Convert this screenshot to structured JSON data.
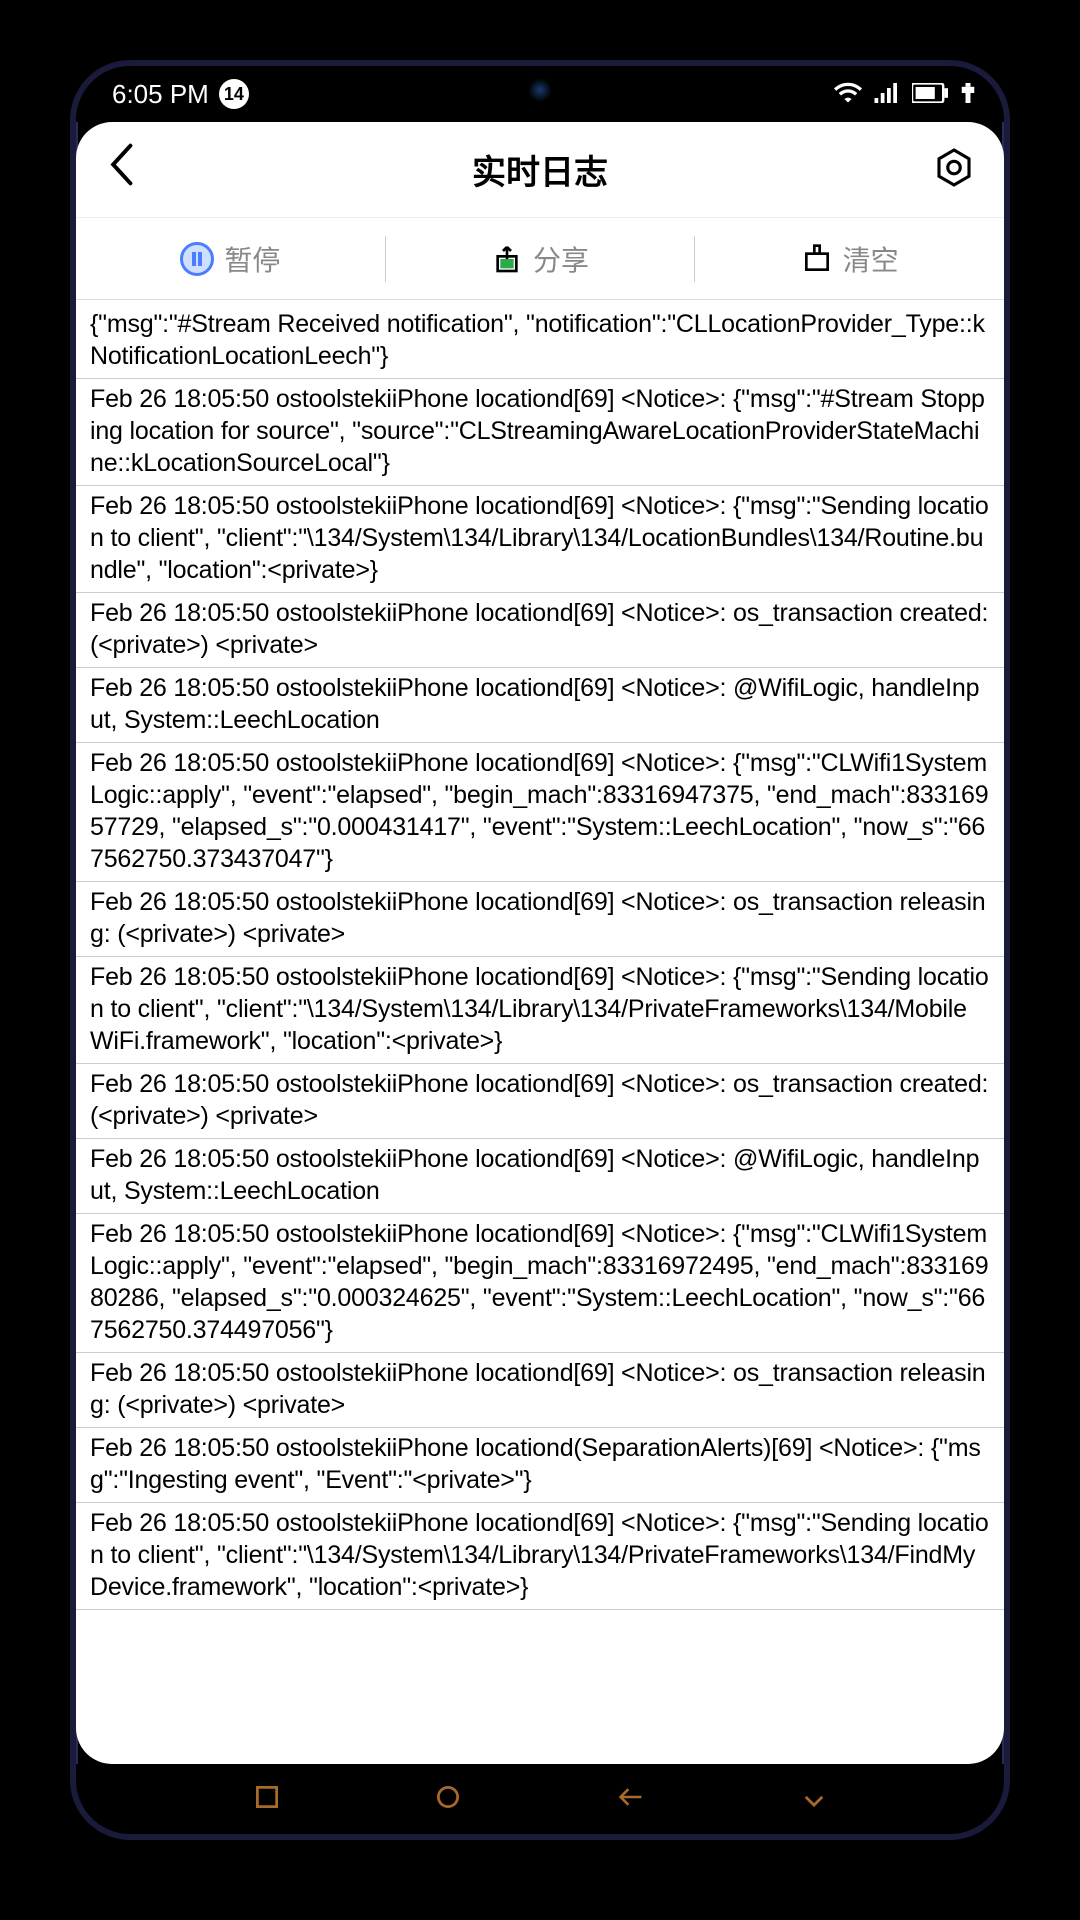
{
  "status": {
    "time": "6:05 PM",
    "notif_count": "14"
  },
  "header": {
    "title": "实时日志"
  },
  "actions": {
    "pause": "暂停",
    "share": "分享",
    "clear": "清空"
  },
  "logs": [
    "{\"msg\":\"#Stream Received notification\", \"notification\":\"CLLocationProvider_Type::kNotificationLocationLeech\"}",
    "Feb 26 18:05:50 ostoolstekiiPhone locationd[69] <Notice>: {\"msg\":\"#Stream Stopping location for source\", \"source\":\"CLStreamingAwareLocationProviderStateMachine::kLocationSourceLocal\"}",
    "Feb 26 18:05:50 ostoolstekiiPhone locationd[69] <Notice>: {\"msg\":\"Sending location to client\", \"client\":\"\\134/System\\134/Library\\134/LocationBundles\\134/Routine.bundle\", \"location\":<private>}",
    "Feb 26 18:05:50 ostoolstekiiPhone locationd[69] <Notice>: os_transaction created: (<private>) <private>",
    "Feb 26 18:05:50 ostoolstekiiPhone locationd[69] <Notice>: @WifiLogic, handleInput, System::LeechLocation",
    "Feb 26 18:05:50 ostoolstekiiPhone locationd[69] <Notice>: {\"msg\":\"CLWifi1SystemLogic::apply\", \"event\":\"elapsed\", \"begin_mach\":83316947375, \"end_mach\":83316957729, \"elapsed_s\":\"0.000431417\", \"event\":\"System::LeechLocation\", \"now_s\":\"667562750.373437047\"}",
    "Feb 26 18:05:50 ostoolstekiiPhone locationd[69] <Notice>: os_transaction releasing: (<private>) <private>",
    "Feb 26 18:05:50 ostoolstekiiPhone locationd[69] <Notice>: {\"msg\":\"Sending location to client\", \"client\":\"\\134/System\\134/Library\\134/PrivateFrameworks\\134/MobileWiFi.framework\", \"location\":<private>}",
    "Feb 26 18:05:50 ostoolstekiiPhone locationd[69] <Notice>: os_transaction created: (<private>) <private>",
    "Feb 26 18:05:50 ostoolstekiiPhone locationd[69] <Notice>: @WifiLogic, handleInput, System::LeechLocation",
    "Feb 26 18:05:50 ostoolstekiiPhone locationd[69] <Notice>: {\"msg\":\"CLWifi1SystemLogic::apply\", \"event\":\"elapsed\", \"begin_mach\":83316972495, \"end_mach\":83316980286, \"elapsed_s\":\"0.000324625\", \"event\":\"System::LeechLocation\", \"now_s\":\"667562750.374497056\"}",
    "Feb 26 18:05:50 ostoolstekiiPhone locationd[69] <Notice>: os_transaction releasing: (<private>) <private>",
    "Feb 26 18:05:50 ostoolstekiiPhone locationd(SeparationAlerts)[69] <Notice>: {\"msg\":\"Ingesting event\", \"Event\":\"<private>\"}",
    "Feb 26 18:05:50 ostoolstekiiPhone locationd[69] <Notice>: {\"msg\":\"Sending location to client\", \"client\":\"\\134/System\\134/Library\\134/PrivateFrameworks\\134/FindMyDevice.framework\", \"location\":<private>}"
  ]
}
